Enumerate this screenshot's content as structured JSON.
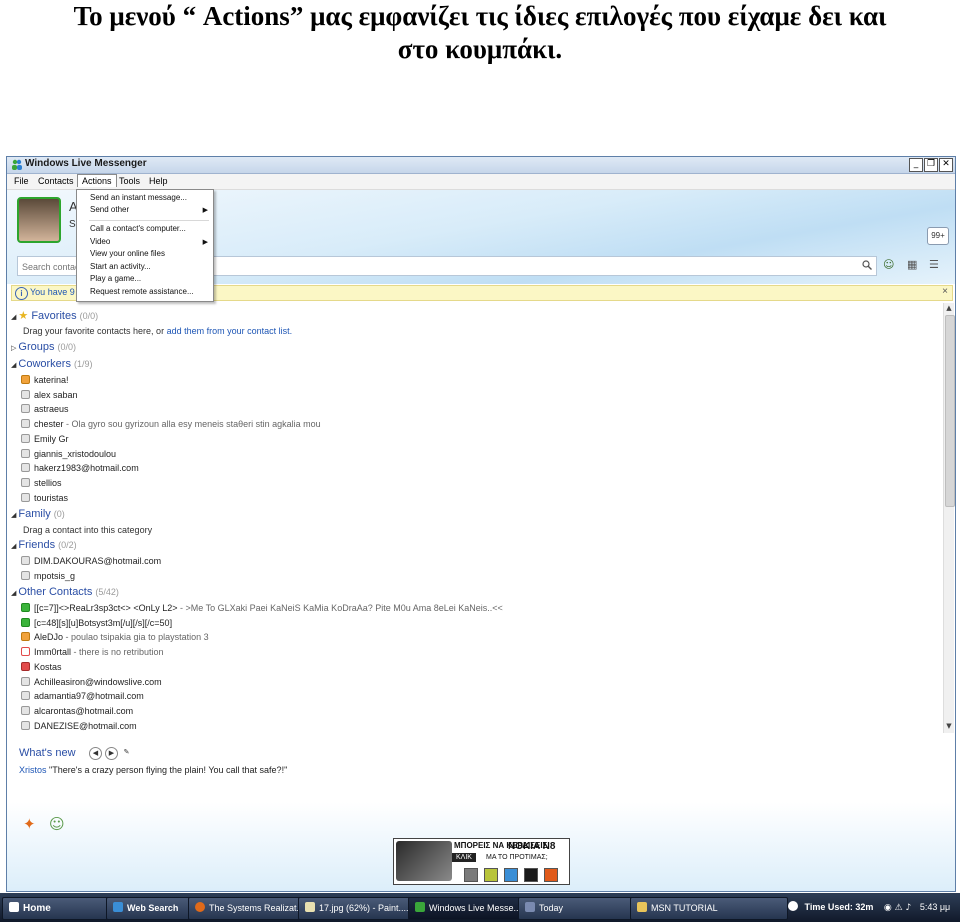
{
  "caption": {
    "line1": "Το μενού “ Actions” μας εμφανίζει τις ίδιες επιλογές που είχαμε δει και",
    "line2": "στο κουμπάκι."
  },
  "window": {
    "title": "Windows Live Messenger",
    "buttons": [
      "_",
      "❐",
      "✕"
    ]
  },
  "menubar": [
    "File",
    "Contacts",
    "Actions",
    "Tools",
    "Help"
  ],
  "actions_menu": {
    "items": [
      {
        "label": "Send an instant message...",
        "submenu": false
      },
      {
        "label": "Send other",
        "submenu": true
      },
      {
        "label": "Call a contact's computer...",
        "submenu": false
      },
      {
        "label": "Video",
        "submenu": true
      },
      {
        "label": "View your online files",
        "submenu": false
      },
      {
        "label": "Start an activity...",
        "submenu": false
      },
      {
        "label": "Play a game...",
        "submenu": false
      },
      {
        "label": "Request remote assistance...",
        "submenu": false
      }
    ]
  },
  "profile": {
    "name_initial": "A",
    "status_initial": "S",
    "badge": "99+"
  },
  "search": {
    "placeholder": "Search contacts or the web..."
  },
  "notice": {
    "text": "You have 9 in",
    "close": "×"
  },
  "groups": {
    "favorites": {
      "name": "Favorites",
      "count": "(0/0)",
      "hint_prefix": "Drag your favorite contacts here, or",
      "hint_link": "add them from your contact list."
    },
    "groups": {
      "name": "Groups",
      "count": "(0/0)"
    },
    "coworkers": {
      "name": "Coworkers",
      "count": "(1/9)"
    },
    "family": {
      "name": "Family",
      "count": "(0)",
      "hint": "Drag a contact into this category"
    },
    "friends": {
      "name": "Friends",
      "count": "(0/2)"
    },
    "other": {
      "name": "Other Contacts",
      "count": "(5/42)"
    }
  },
  "coworkers": [
    {
      "name": "katerina!",
      "msg": "",
      "status": "away"
    },
    {
      "name": "alex saban",
      "msg": "",
      "status": "offline"
    },
    {
      "name": "astraeus",
      "msg": "",
      "status": "offline"
    },
    {
      "name": "chester",
      "msg": " - Ola gyro sou gyrizoun alla esy meneis staθeri stin agkalia mou",
      "status": "offline"
    },
    {
      "name": "Emily Gr",
      "msg": "",
      "status": "offline"
    },
    {
      "name": "giannis_xristodoulou",
      "msg": "",
      "status": "offline"
    },
    {
      "name": "hakerz1983@hotmail.com",
      "msg": "",
      "status": "offline"
    },
    {
      "name": "stellios",
      "msg": "",
      "status": "offline"
    },
    {
      "name": "touristas",
      "msg": "",
      "status": "offline"
    }
  ],
  "friends": [
    {
      "name": "DIM.DAKOURAS@hotmail.com",
      "msg": "",
      "status": "offline"
    },
    {
      "name": "mpotsis_g",
      "msg": "",
      "status": "offline"
    }
  ],
  "others": [
    {
      "name": "[[c=7]]<>ReaLr3sp3ct<> <OnLy L2>",
      "msg": " - >Me To GLXaki Paei KaNeiS KaMia KoDraAa? Pite M0u Ama 8eLei KaNeis..<<",
      "status": "online"
    },
    {
      "name": "[c=48][s][u]Botsyst3m[/u][/s][/c=50]",
      "msg": "",
      "status": "online"
    },
    {
      "name": "AleDJo",
      "msg": " - poulao tsipakia gia to playstation 3",
      "status": "away"
    },
    {
      "name": "Imm0rtall",
      "msg": " - there is no retribution",
      "status": "blocked"
    },
    {
      "name": "Kostas",
      "msg": "",
      "status": "busy"
    },
    {
      "name": "Achilleasiron@windowslive.com",
      "msg": "",
      "status": "offline"
    },
    {
      "name": "adamantia97@hotmail.com",
      "msg": "",
      "status": "offline"
    },
    {
      "name": "alcarontas@hotmail.com",
      "msg": "",
      "status": "offline"
    },
    {
      "name": "DANEZISE@hotmail.com",
      "msg": "",
      "status": "offline"
    }
  ],
  "whats_new": {
    "title": "What's new",
    "who": "Xristos",
    "text": " \"There's a crazy person flying the plain! You call that safe?!\""
  },
  "ad": {
    "line1": "ΜΠΟΡΕΙΣ ΝΑ ΚΕΡΔΙΣΕΙΣ",
    "brand": "NOKIA N8",
    "button": "ΚΛΙΚ",
    "line2": "ΜΑ ΤΟ ΠΡΟΤΙΜΑΣ;",
    "swatches": [
      "#7a7a7a",
      "#b8c43a",
      "#3a8ed6",
      "#1a1a1a",
      "#e05a1a"
    ]
  },
  "taskbar": {
    "items": [
      {
        "label": "Home"
      },
      {
        "label": "Web Search"
      },
      {
        "label": "The Systems Realizat..."
      },
      {
        "label": "17.jpg (62%) - Paint...."
      },
      {
        "label": "Windows Live Messe..."
      },
      {
        "label": "Today"
      },
      {
        "label": "MSN TUTORIAL"
      }
    ],
    "time_used": "Time Used: 32m",
    "clock": "5:43 μμ"
  },
  "colors": {
    "accent": "#2a4ea5",
    "link": "#1e56b5",
    "online": "#3ab33a",
    "away": "#f1a23b",
    "busy": "#e24b4b"
  }
}
